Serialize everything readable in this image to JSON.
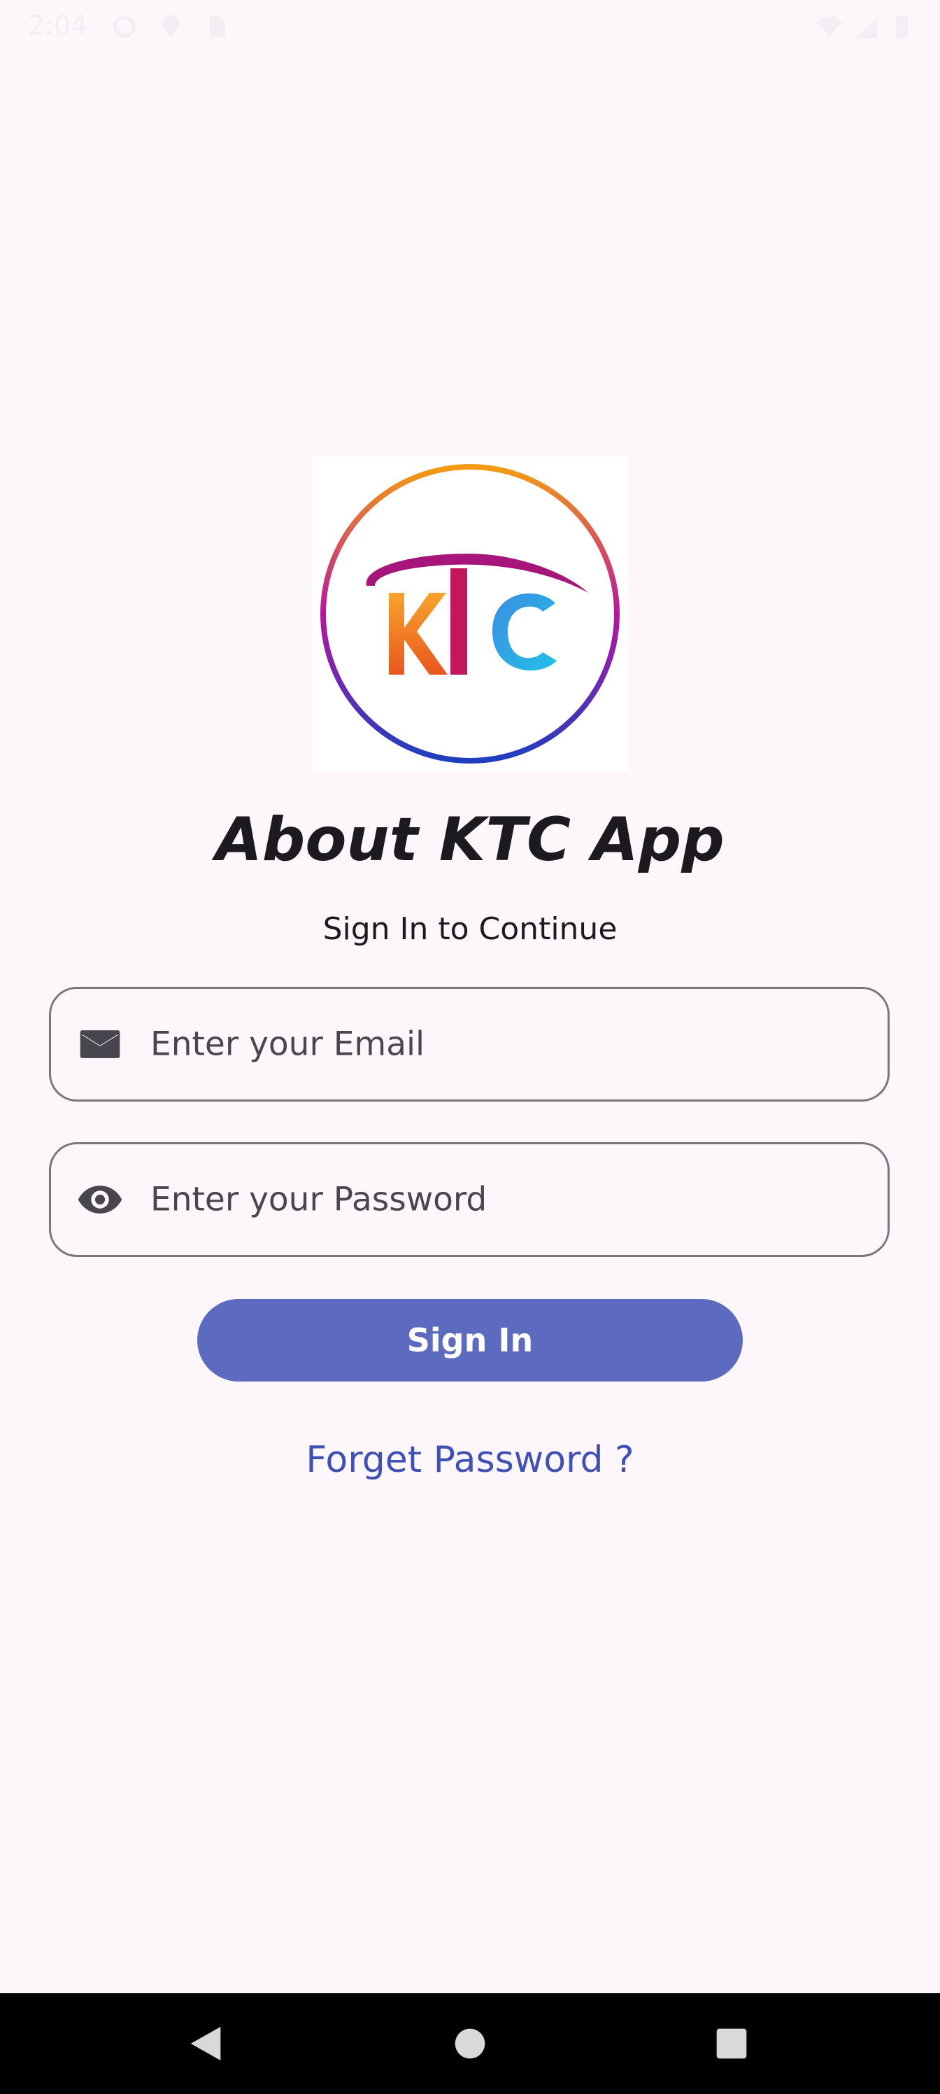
{
  "status_bar": {
    "time": "2:04"
  },
  "logo": {
    "letters": "KTC",
    "colors": {
      "ring_top": "#f39c12",
      "ring_mid": "#c2185b",
      "ring_bottom": "#1e3fc0",
      "k": "#f57c00",
      "t": "#c2185b",
      "c": "#1ea3e0"
    }
  },
  "title": "About KTC App",
  "subtitle": "Sign In to Continue",
  "email_field": {
    "placeholder": "Enter your Email",
    "icon": "mail-icon"
  },
  "password_field": {
    "placeholder": "Enter your Password",
    "icon": "eye-icon"
  },
  "signin_button": {
    "label": "Sign In",
    "color": "#5c6bc0"
  },
  "forget_link": "Forget Password ?",
  "nav_bar": {
    "icons": [
      "back-icon",
      "home-icon",
      "recents-icon"
    ]
  }
}
